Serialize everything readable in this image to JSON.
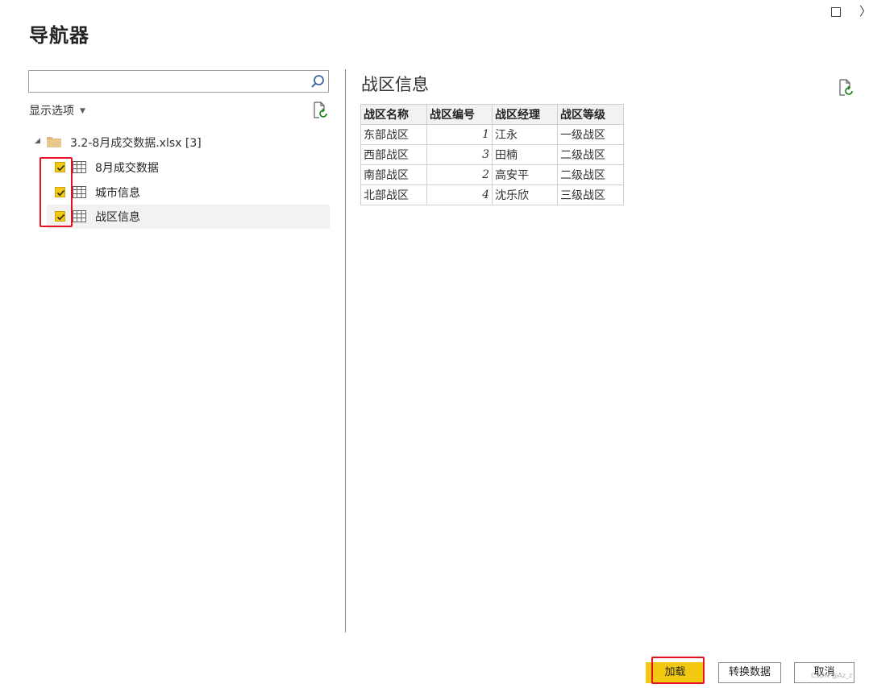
{
  "window": {
    "maximize_icon": "maximize-icon",
    "close_glyph": "〉"
  },
  "title": "导航器",
  "search": {
    "value": "",
    "placeholder": ""
  },
  "display_options": {
    "label": "显示选项",
    "caret": "▼"
  },
  "tree": {
    "file": {
      "label": "3.2-8月成交数据.xlsx [3]",
      "caret": "◢"
    },
    "items": [
      {
        "label": "8月成交数据",
        "checked": true,
        "selected": false
      },
      {
        "label": "城市信息",
        "checked": true,
        "selected": false
      },
      {
        "label": "战区信息",
        "checked": true,
        "selected": true
      }
    ]
  },
  "preview": {
    "title": "战区信息",
    "columns": [
      "战区名称",
      "战区编号",
      "战区经理",
      "战区等级"
    ],
    "rows": [
      [
        "东部战区",
        "1",
        "江永",
        "一级战区"
      ],
      [
        "西部战区",
        "3",
        "田楠",
        "二级战区"
      ],
      [
        "南部战区",
        "2",
        "高安平",
        "二级战区"
      ],
      [
        "北部战区",
        "4",
        "沈乐欣",
        "三级战区"
      ]
    ]
  },
  "buttons": {
    "load": "加载",
    "transform": "转换数据",
    "cancel": "取消"
  },
  "watermark": "CSDN @Az_z",
  "colors": {
    "accent": "#f2c811",
    "highlight_red": "#e81123",
    "selected_row": "#f3f2f1"
  }
}
